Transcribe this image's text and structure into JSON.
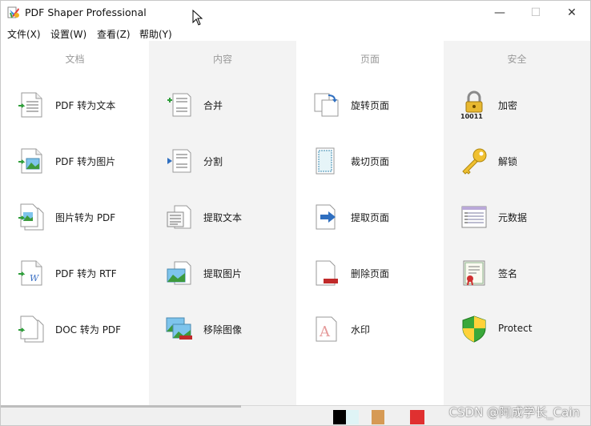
{
  "window": {
    "title": "PDF Shaper Professional",
    "controls": {
      "minimize": "—",
      "maximize": "☐",
      "close": "✕"
    }
  },
  "menu": [
    "文件(X)",
    "设置(W)",
    "查看(Z)",
    "帮助(Y)"
  ],
  "columns": [
    {
      "title": "文档",
      "background": "#ffffff",
      "items": [
        {
          "label": "PDF 转为文本",
          "icon": "pdf-to-text-icon"
        },
        {
          "label": "PDF 转为图片",
          "icon": "pdf-to-image-icon"
        },
        {
          "label": "图片转为 PDF",
          "icon": "image-to-pdf-icon"
        },
        {
          "label": "PDF 转为 RTF",
          "icon": "pdf-to-rtf-icon"
        },
        {
          "label": "DOC 转为 PDF",
          "icon": "doc-to-pdf-icon"
        }
      ]
    },
    {
      "title": "内容",
      "background": "#f3f3f3",
      "items": [
        {
          "label": "合并",
          "icon": "merge-icon"
        },
        {
          "label": "分割",
          "icon": "split-icon"
        },
        {
          "label": "提取文本",
          "icon": "extract-text-icon"
        },
        {
          "label": "提取图片",
          "icon": "extract-image-icon"
        },
        {
          "label": "移除图像",
          "icon": "remove-image-icon"
        }
      ]
    },
    {
      "title": "页面",
      "background": "#ffffff",
      "items": [
        {
          "label": "旋转页面",
          "icon": "rotate-page-icon"
        },
        {
          "label": "裁切页面",
          "icon": "crop-page-icon"
        },
        {
          "label": "提取页面",
          "icon": "extract-page-icon"
        },
        {
          "label": "删除页面",
          "icon": "delete-page-icon"
        },
        {
          "label": "水印",
          "icon": "watermark-icon"
        }
      ]
    },
    {
      "title": "安全",
      "background": "#f3f3f3",
      "items": [
        {
          "label": "加密",
          "icon": "encrypt-lock-icon"
        },
        {
          "label": "解锁",
          "icon": "unlock-key-icon"
        },
        {
          "label": "元数据",
          "icon": "metadata-icon"
        },
        {
          "label": "签名",
          "icon": "signature-certificate-icon"
        },
        {
          "label": "Protect",
          "icon": "protect-shield-icon"
        }
      ]
    }
  ],
  "overlay": {
    "watermark_text": "CSDN @阿成学长_Cain",
    "swatches": [
      "#000000",
      "#dff4f6",
      "#d69a55",
      "#e03030"
    ]
  }
}
